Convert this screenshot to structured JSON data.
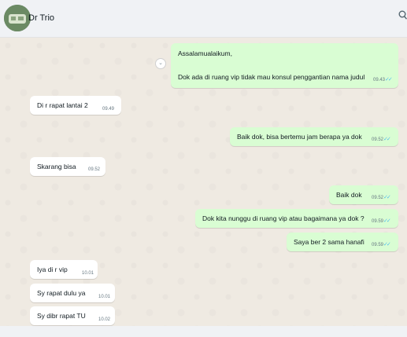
{
  "header": {
    "contact_name": "Dr Trio"
  },
  "messages": [
    {
      "direction": "out",
      "text": "Assalamualaikum,",
      "time": "",
      "status": ""
    },
    {
      "direction": "out",
      "text": "Dok ada di ruang vip tidak mau konsul penggantian nama judul",
      "time": "09.43",
      "status": "read"
    },
    {
      "direction": "in",
      "text": "Di r rapat lantai 2",
      "time": "09.49"
    },
    {
      "direction": "out",
      "text": "Baik dok, bisa bertemu jam berapa ya dok",
      "time": "09.52",
      "status": "read"
    },
    {
      "direction": "in",
      "text": "Skarang bisa",
      "time": "09.52"
    },
    {
      "direction": "out",
      "text": "Baik dok",
      "time": "09.52",
      "status": "read"
    },
    {
      "direction": "out",
      "text": "Dok kita nunggu di ruang vip atau bagaimana ya dok ?",
      "time": "09.59",
      "status": "read"
    },
    {
      "direction": "out",
      "text": "Saya ber 2 sama hanafi",
      "time": "09.59",
      "status": "read"
    },
    {
      "direction": "in",
      "text": "Iya di r vip",
      "time": "10.01"
    },
    {
      "direction": "in",
      "text": "Sy rapat dulu ya",
      "time": "10.01"
    },
    {
      "direction": "in",
      "text": "Sy dibr rapat TU",
      "time": "10.02"
    }
  ],
  "icons": {
    "search": "search-icon",
    "avatar": "avatar",
    "read_ticks": "double-check-icon",
    "scroll_down": "chevron-down-icon"
  },
  "colors": {
    "outgoing_bubble": "#d9fdd3",
    "incoming_bubble": "#ffffff",
    "chat_background": "#efeae2",
    "read_ticks": "#53bdeb"
  }
}
